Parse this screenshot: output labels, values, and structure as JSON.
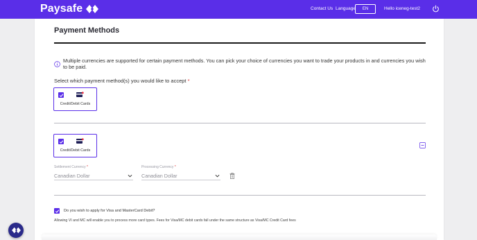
{
  "header": {
    "brand": "Paysafe",
    "logo_icon": "paysafe-diamond-icon",
    "contact_label": "Contact Us",
    "language_label": "Language",
    "language_value": "EN",
    "user_greeting": "Hello iceneg-test2",
    "power_icon": "power-icon"
  },
  "page": {
    "title": "Payment Methods",
    "info_text": "Multiple currencies are supported for certain payment methods. You can pick your choice of currencies you want to trade your products in and currencies you wish to be paid.",
    "select_prompt": "Select which payment method(s) you would like to accept",
    "required_mark": "*"
  },
  "methods": [
    {
      "label": "Credit/Debit Cards",
      "checked": true,
      "icon": "credit-card-icon"
    }
  ],
  "configured_method": {
    "label": "Credit/Debit Cards",
    "checked": true,
    "settlement_currency_label": "Settlement Currency",
    "settlement_currency_value": "Canadian Dollar",
    "processing_currency_label": "Processing Currency",
    "processing_currency_value": "Canadian Dollar",
    "required_mark": "*"
  },
  "debit": {
    "question": "Do you wish to apply for Visa and MasterCard Debit?",
    "checked": true,
    "note": "Allowing VI and MC will enable you to process more card types. Fees for Visa/MC debit cards fall under the same structure as Visa/MC Credit Card fees"
  },
  "colors": {
    "brand": "#5a2ee8",
    "required": "#dd3333",
    "fab": "#2a2a8a"
  }
}
